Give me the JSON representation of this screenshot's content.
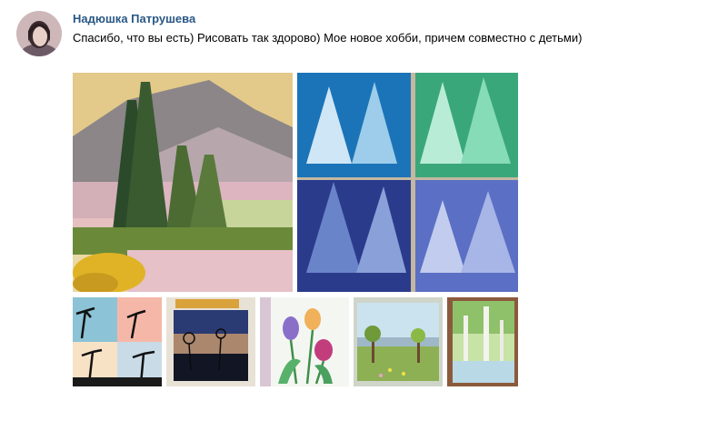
{
  "post": {
    "author_name": "Надюшка Патрушева",
    "text": "Спасибо, что вы есть) Рисовать так здорово) Мое новое хобби, причем совместно с детьми)"
  },
  "photos": [
    {
      "subject": "mountain-pine-landscape-painting"
    },
    {
      "subject": "blue-winter-trees-paintings"
    },
    {
      "subject": "palm-silhouettes-sunset-paintings"
    },
    {
      "subject": "dandelion-silhouette-night-painting"
    },
    {
      "subject": "tulips-watercolor-painting"
    },
    {
      "subject": "meadow-with-trees-painting"
    },
    {
      "subject": "birch-trees-painting"
    }
  ]
}
